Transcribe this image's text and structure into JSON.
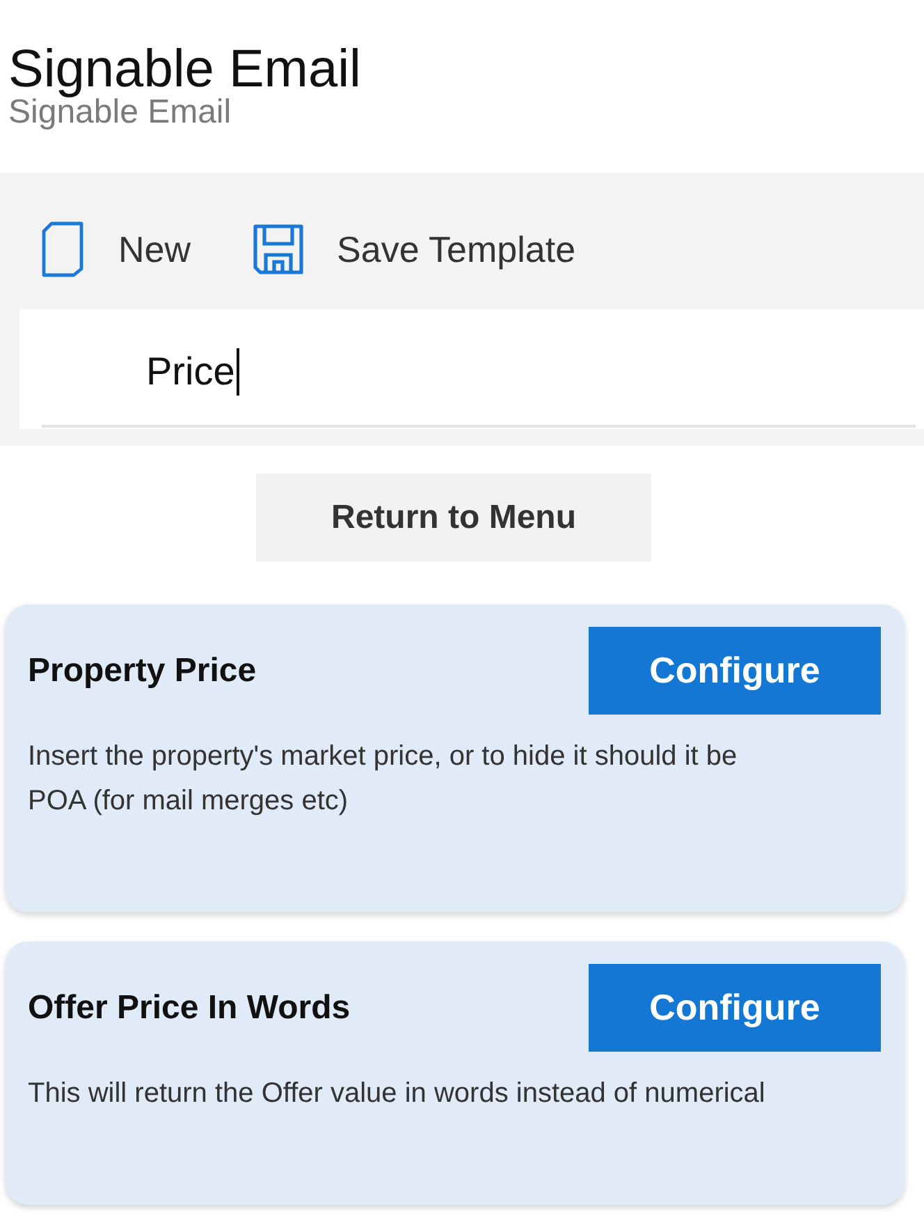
{
  "header": {
    "title": "Signable Email",
    "subtitle": "Signable Email"
  },
  "toolbar": {
    "buttons": [
      {
        "kind": "new",
        "label": "New"
      },
      {
        "kind": "save",
        "label": "Save Template"
      }
    ]
  },
  "search": {
    "value": "Price",
    "focused": true
  },
  "return_button": {
    "label": "Return to Menu"
  },
  "cards": [
    {
      "title": "Property Price",
      "button": "Configure",
      "description": "Insert the property's market price, or to hide it should it be POA (for mail merges etc)"
    },
    {
      "title": "Offer Price In Words",
      "button": "Configure",
      "description": "This will return the Offer value in words instead of numerical"
    }
  ]
}
